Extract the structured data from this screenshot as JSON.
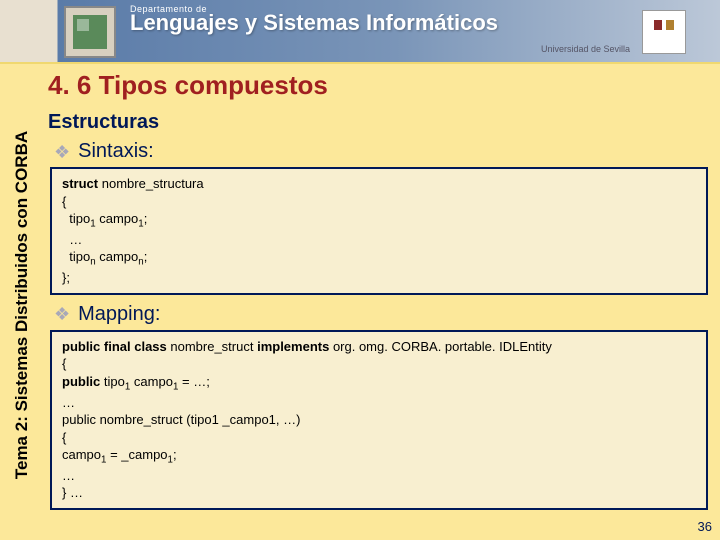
{
  "banner": {
    "dept": "Departamento de",
    "title": "Lenguajes y Sistemas Informáticos",
    "university": "Universidad de Sevilla"
  },
  "sidebar": {
    "label": "Tema 2: Sistemas Distribuidos con CORBA"
  },
  "slide": {
    "title": "4. 6 Tipos compuestos",
    "subtitle": "Estructuras",
    "bullet1": "Sintaxis:",
    "bullet2": "Mapping:"
  },
  "code1": {
    "l1a": "struct ",
    "l1b": "nombre_structura",
    "l2": "{",
    "l3a": "tipo",
    "l3b": "1",
    "l3c": " campo",
    "l3d": "1",
    "l3e": ";",
    "l4": "…",
    "l5a": "tipo",
    "l5b": "n",
    "l5c": " campo",
    "l5d": "n",
    "l5e": ";",
    "l6": "};"
  },
  "code2": {
    "l1a": "public final class ",
    "l1b": "nombre_struct ",
    "l1c": "implements ",
    "l1d": "org. omg. CORBA. portable. IDLEntity",
    "l2": "{",
    "l3a": " public ",
    "l3b": "tipo",
    "l3c": "1",
    "l3d": " campo",
    "l3e": "1",
    "l3f": " = …;",
    "l4": " …",
    "l5a": " public nombre_struct (tipo",
    "l5b": "1 _campo",
    "l5c": "1, …)",
    "l6": " {",
    "l7a": "  campo",
    "l7b": "1",
    "l7c": " = _campo",
    "l7d": "1",
    "l7e": ";",
    "l8": "  …",
    "l9": " } …"
  },
  "page_number": "36"
}
